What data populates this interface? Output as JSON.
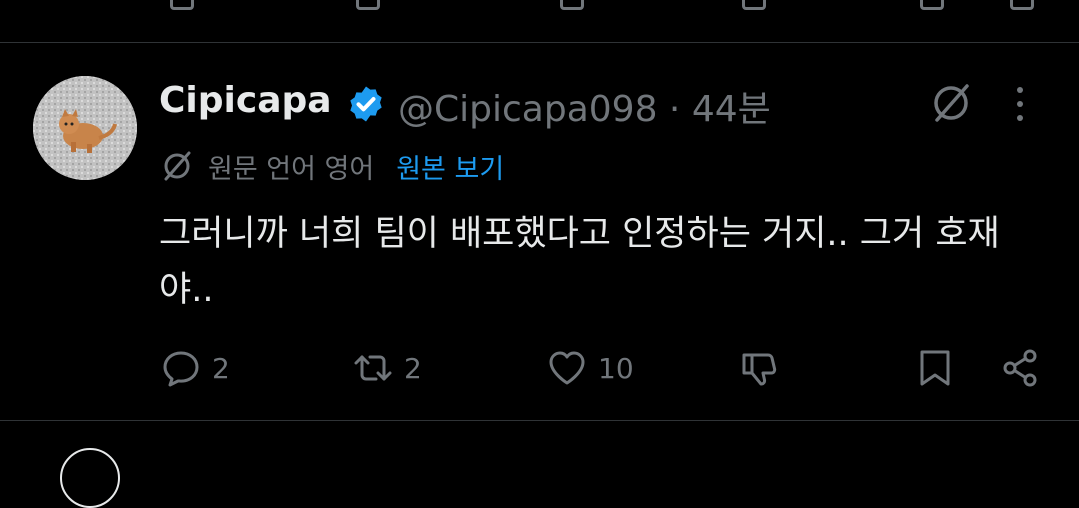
{
  "tweet": {
    "display_name": "Cipicapa",
    "handle": "@Cipicapa098",
    "separator": " · ",
    "time": "44분",
    "translation_note": "원문 언어 영어",
    "show_original_label": "원본 보기",
    "text": "그러니까 너희 팀이 배포했다고 인정하는 거지.. 그거 호재야..",
    "actions": {
      "replies": "2",
      "reposts": "2",
      "likes": "10"
    }
  },
  "colors": {
    "background": "#000000",
    "text": "#e7e9ea",
    "secondary": "#71767b",
    "accent": "#1d9bf0",
    "divider": "#2f3336"
  },
  "icons": [
    "verified-badge-icon",
    "grok-icon",
    "more-icon",
    "translate-icon",
    "reply-icon",
    "repost-icon",
    "like-icon",
    "dislike-icon",
    "bookmark-icon",
    "share-icon"
  ]
}
